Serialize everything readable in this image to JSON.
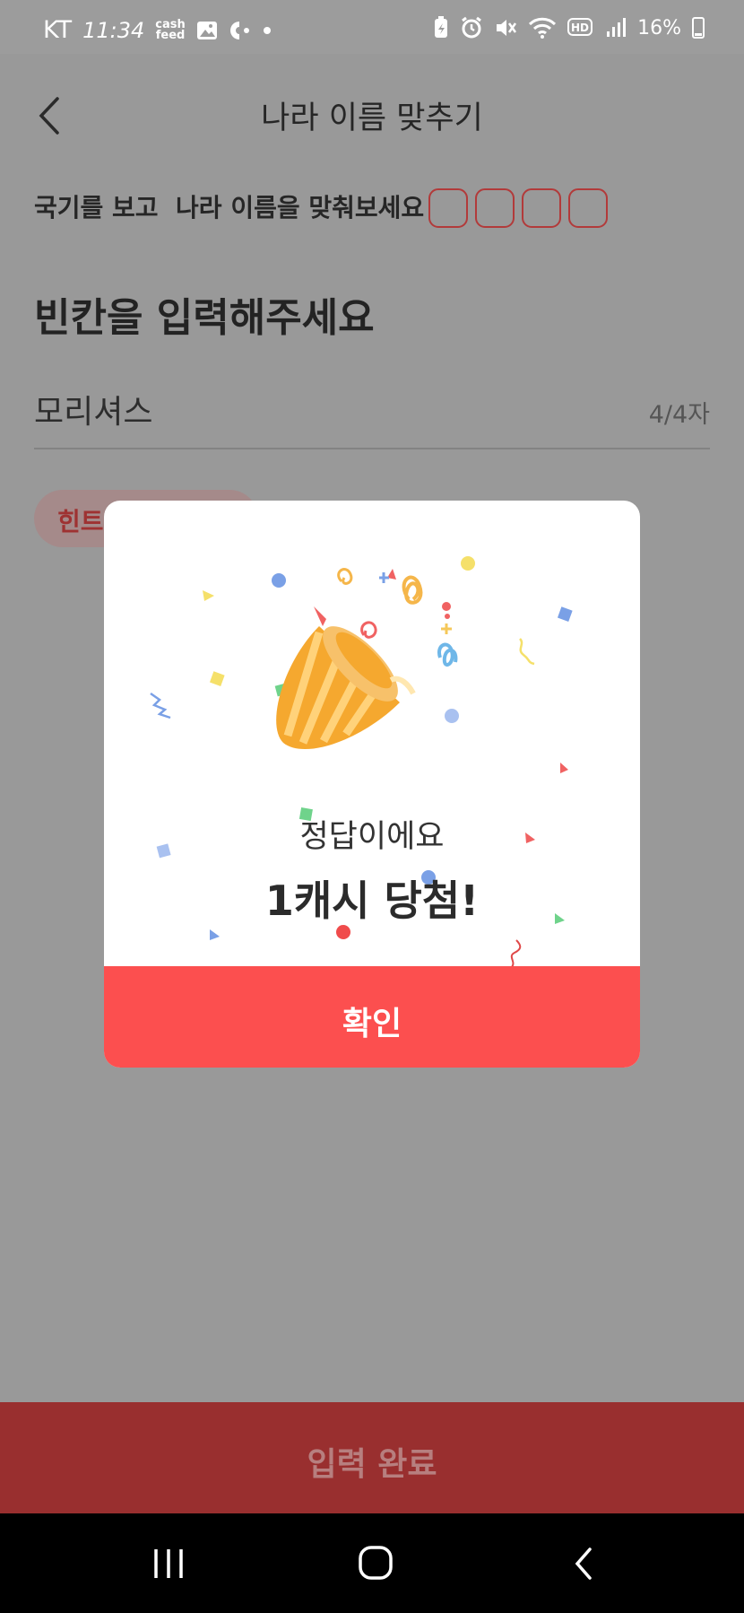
{
  "status_bar": {
    "carrier": "KT",
    "time": "11:34",
    "app_badge": "cash feed",
    "battery": "16%"
  },
  "header": {
    "title": "나라 이름 맞추기"
  },
  "quiz": {
    "question": "국기를 보고  나라 이름을 맞춰보세요",
    "prompt": "빈칸을 입력해주세요",
    "answer": "모리셔스",
    "char_count": "4/4자",
    "hint_label": "힌트"
  },
  "modal": {
    "message": "정답이에요",
    "prize": "1캐시 당첨!",
    "confirm_label": "확인"
  },
  "submit": {
    "label": "입력 완료"
  },
  "colors": {
    "accent": "#fc4f4f",
    "dimmed_accent": "#992f2f",
    "overlay": "#999999"
  }
}
